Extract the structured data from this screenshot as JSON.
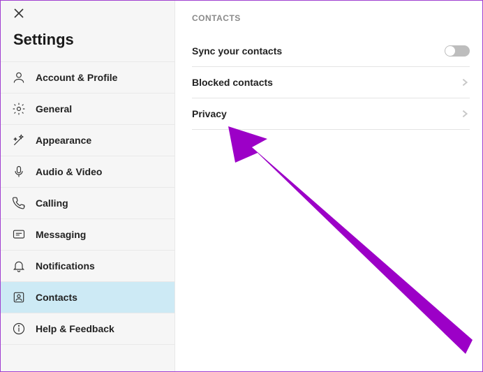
{
  "sidebar": {
    "title": "Settings",
    "items": [
      {
        "label": "Account & Profile"
      },
      {
        "label": "General"
      },
      {
        "label": "Appearance"
      },
      {
        "label": "Audio & Video"
      },
      {
        "label": "Calling"
      },
      {
        "label": "Messaging"
      },
      {
        "label": "Notifications"
      },
      {
        "label": "Contacts"
      },
      {
        "label": "Help & Feedback"
      }
    ]
  },
  "content": {
    "section_header": "CONTACTS",
    "rows": {
      "sync": "Sync your contacts",
      "blocked": "Blocked contacts",
      "privacy": "Privacy"
    }
  },
  "colors": {
    "accent_arrow": "#9c00c7",
    "sidebar_active_bg": "#cdeaf5"
  }
}
